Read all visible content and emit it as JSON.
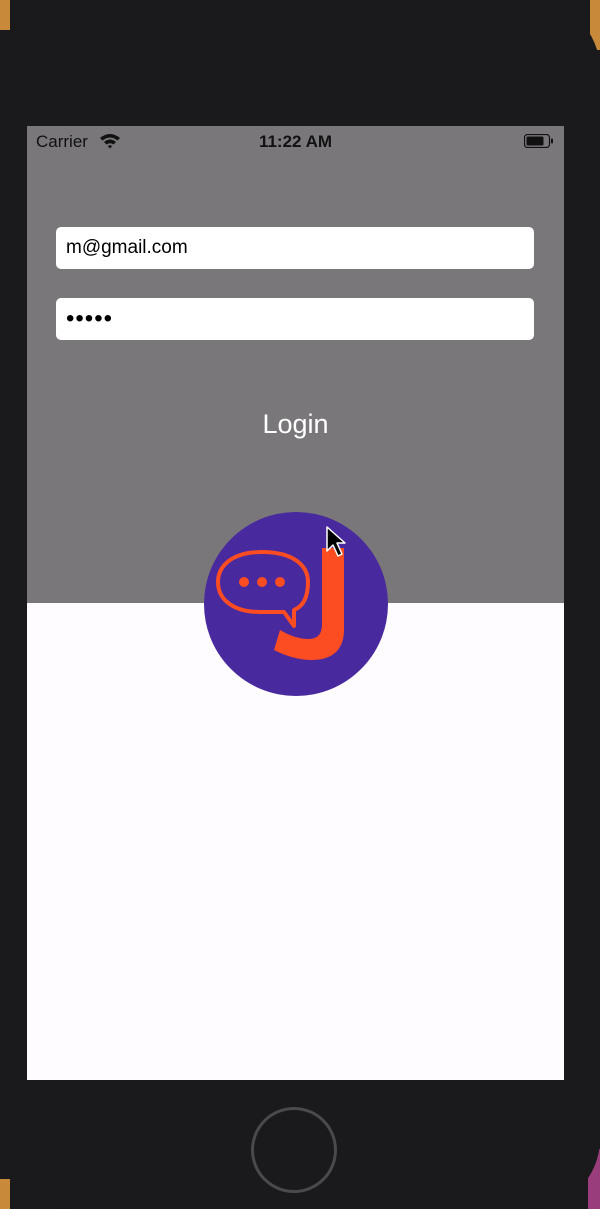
{
  "status_bar": {
    "carrier": "Carrier",
    "time": "11:22 AM",
    "wifi_icon": "wifi-icon",
    "battery_icon": "battery-icon"
  },
  "form": {
    "email_value": "m@gmail.com",
    "password_value": "•••••",
    "login_label": "Login"
  },
  "logo": {
    "icon": "chat-bubble-j-logo",
    "background_color": "#48299e",
    "accent_color": "#fb4c22"
  },
  "colors": {
    "top_panel": "#79777a",
    "screen_background": "#fefcfe",
    "device_frame": "#1a191c"
  }
}
